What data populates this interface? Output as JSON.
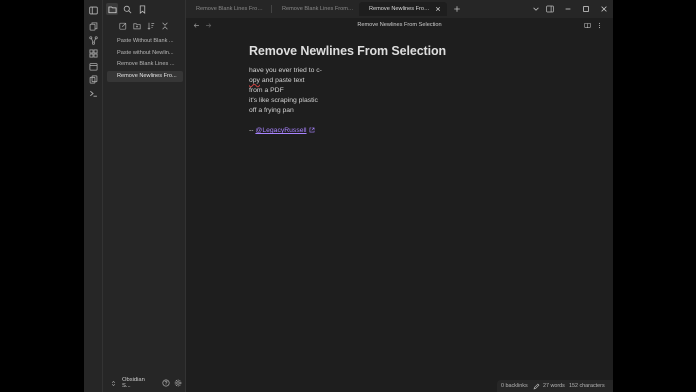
{
  "sidebar": {
    "files": [
      {
        "label": "Paste Without Blank ...",
        "active": false
      },
      {
        "label": "Paste without Newlin...",
        "active": false
      },
      {
        "label": "Remove Blank Lines ...",
        "active": false
      },
      {
        "label": "Remove Newlines Fro...",
        "active": true
      }
    ],
    "vault_name": "Obsidian S..."
  },
  "tabs": [
    {
      "label": "Remove Blank Lines From S...",
      "active": false
    },
    {
      "label": "Remove Blank Lines From S...",
      "active": false
    },
    {
      "label": "Remove Newlines From ...",
      "active": true
    }
  ],
  "view": {
    "title": "Remove Newlines From Selection"
  },
  "note": {
    "title": "Remove Newlines From Selection",
    "lines": [
      "have you ever tried to c-",
      "opy and paste text",
      "from a PDF",
      "it's like scraping plastic",
      "off a frying pan"
    ],
    "credit_prefix": "--",
    "credit_link": "@LegacyRussell"
  },
  "status": {
    "backlinks": "0 backlinks",
    "words": "27 words",
    "characters": "152 characters"
  },
  "colors": {
    "accent": "#a883ff",
    "background": "#1e1e1e",
    "sidebar": "#262626"
  }
}
